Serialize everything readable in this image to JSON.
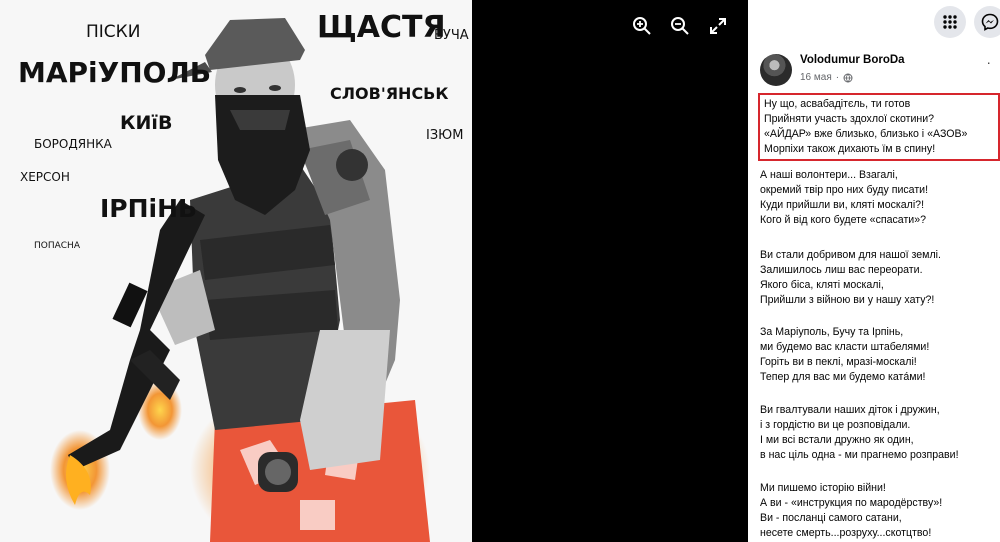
{
  "photo_words": {
    "piski": "ПІСКИ",
    "shchastia": "ЩАСТЯ",
    "bucha": "БУЧА",
    "mariupol": "МАРіУПОЛЬ",
    "sloviansk": "СЛОВ'ЯНСЬК",
    "kyiv": "КИїВ",
    "izium": "ІЗЮМ",
    "borodianka": "БОРОДЯНКА",
    "kherson": "ХЕРСОН",
    "irpin": "ІРПіНЬ",
    "popasna": "ПОПАСНА"
  },
  "viewer_icons": [
    "zoom-in-icon",
    "zoom-out-icon",
    "fullscreen-icon"
  ],
  "post": {
    "author": "Volodumur BoroDa",
    "date": "16 мая",
    "more": "·",
    "stanzas": [
      [
        "Ну що, асвабадітєль, ти готов",
        "Прийняти участь здохлої скотини?",
        "«АЙДАР» вже близько, близько і «АЗОВ»",
        "Морпіхи також дихають їм в спину!"
      ],
      [
        "А наші волонтери... Взагалі,",
        "окремий твір про них буду писати!",
        "Куди прийшли ви, кляті москалі?!",
        "Кого й від кого будете «спасати»?"
      ],
      [
        "Ви стали добривом для нашої землі.",
        "Залишилось лиш вас переорати.",
        "Якого біса, кляті москалі,",
        "Прийшли з війною ви у нашу хату?!"
      ],
      [
        "За Маріуполь, Бучу та Ірпінь,",
        "ми будемо вас класти штабелями!",
        "Горіть ви в пеклі, мразі-москалі!",
        "Тепер для вас ми будемо катáми!"
      ],
      [
        "Ви гвалтували наших діток і дружин,",
        "і з гордістю ви це розповідали.",
        "І ми всі встали дружно як один,",
        "в нас ціль одна - ми прагнемо розправи!"
      ],
      [
        "Ми пишемо історію війни!",
        "А ви - «инструкция по мародёрству»!",
        "Ви - посланці самого сатани,",
        "несете смерть...розруху...скотцтво!"
      ]
    ]
  },
  "colors": {
    "highlight_border": "#d6262d",
    "fire": "#f28b20"
  }
}
